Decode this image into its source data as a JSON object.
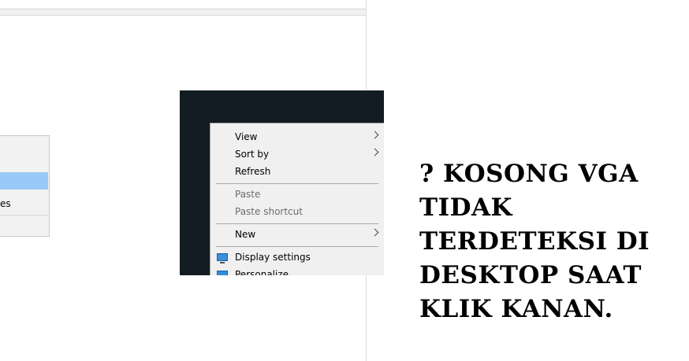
{
  "background_window": {
    "menu_fragment_text": "es"
  },
  "context_menu": {
    "items": [
      {
        "label": "View",
        "has_submenu": true,
        "enabled": true
      },
      {
        "label": "Sort by",
        "has_submenu": true,
        "enabled": true
      },
      {
        "label": "Refresh",
        "has_submenu": false,
        "enabled": true
      },
      {
        "label": "Paste",
        "has_submenu": false,
        "enabled": false
      },
      {
        "label": "Paste shortcut",
        "has_submenu": false,
        "enabled": false
      },
      {
        "label": "New",
        "has_submenu": true,
        "enabled": true
      },
      {
        "label": "Display settings",
        "icon": "display-icon",
        "has_submenu": false,
        "enabled": true
      },
      {
        "label": "Personalize",
        "icon": "personalize-icon",
        "has_submenu": false,
        "enabled": true
      }
    ]
  },
  "caption": {
    "lines": [
      "? KOSONG VGA",
      "TIDAK",
      "TERDETEKSI DI",
      "DESKTOP SAAT",
      "KLIK KANAN."
    ]
  },
  "colors": {
    "desktop_background": "#121c22",
    "menu_background": "#f0f0f0",
    "highlight": "#99c9f7"
  }
}
